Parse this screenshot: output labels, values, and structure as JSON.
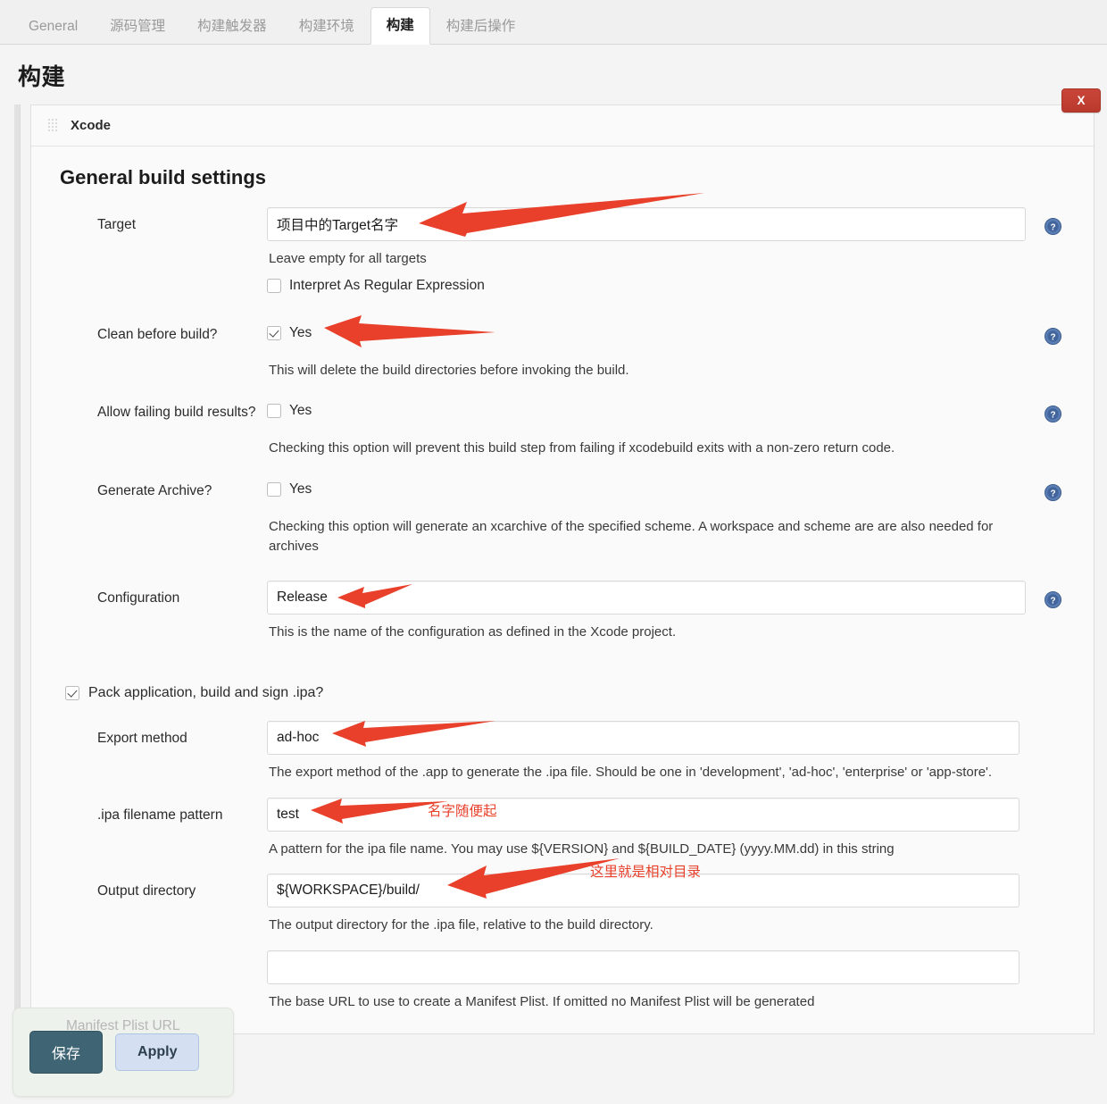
{
  "tabs": [
    {
      "label": "General",
      "active": false
    },
    {
      "label": "源码管理",
      "active": false
    },
    {
      "label": "构建触发器",
      "active": false
    },
    {
      "label": "构建环境",
      "active": false
    },
    {
      "label": "构建",
      "active": true
    },
    {
      "label": "构建后操作",
      "active": false
    }
  ],
  "page": {
    "title": "构建"
  },
  "builder": {
    "name": "Xcode",
    "close_label": "X",
    "section_title": "General build settings"
  },
  "fields": {
    "target": {
      "label": "Target",
      "value": "项目中的Target名字",
      "hint": "Leave empty for all targets",
      "regex_label": "Interpret As Regular Expression",
      "regex_checked": false
    },
    "clean_before_build": {
      "label": "Clean before build?",
      "yes_label": "Yes",
      "checked": true,
      "hint": "This will delete the build directories before invoking the build."
    },
    "allow_failing": {
      "label": "Allow failing build results?",
      "yes_label": "Yes",
      "checked": false,
      "hint": "Checking this option will prevent this build step from failing if xcodebuild exits with a non-zero return code."
    },
    "generate_archive": {
      "label": "Generate Archive?",
      "yes_label": "Yes",
      "checked": false,
      "hint": "Checking this option will generate an xcarchive of the specified scheme. A workspace and scheme are are also needed for archives"
    },
    "configuration": {
      "label": "Configuration",
      "value": "Release",
      "hint": "This is the name of the configuration as defined in the Xcode project."
    },
    "pack_application": {
      "label": "Pack application, build and sign .ipa?",
      "checked": true
    },
    "export_method": {
      "label": "Export method",
      "value": "ad-hoc",
      "hint": "The export method of the .app to generate the .ipa file. Should be one in 'development', 'ad-hoc', 'enterprise' or 'app-store'."
    },
    "ipa_filename_pattern": {
      "label": ".ipa filename pattern",
      "value": "test",
      "hint": "A pattern for the ipa file name. You may use ${VERSION} and ${BUILD_DATE} (yyyy.MM.dd) in this string"
    },
    "output_directory": {
      "label": "Output directory",
      "value": "${WORKSPACE}/build/",
      "hint": "The output directory for the .ipa file, relative to the build directory."
    },
    "manifest_plist_url": {
      "label": "Manifest Plist URL",
      "value": "",
      "hint": "The base URL to use to create a Manifest Plist. If omitted no Manifest Plist will be generated"
    }
  },
  "annotations": [
    {
      "text": "名字随便起"
    },
    {
      "text": "这里就是相对目录"
    }
  ],
  "savebar": {
    "save_label": "保存",
    "apply_label": "Apply"
  },
  "colors": {
    "annotation_red": "#e8402a",
    "close_button": "#c0392b",
    "save_button": "#3f6575",
    "apply_button": "#d4e0f2",
    "help_icon": "#41659c"
  }
}
